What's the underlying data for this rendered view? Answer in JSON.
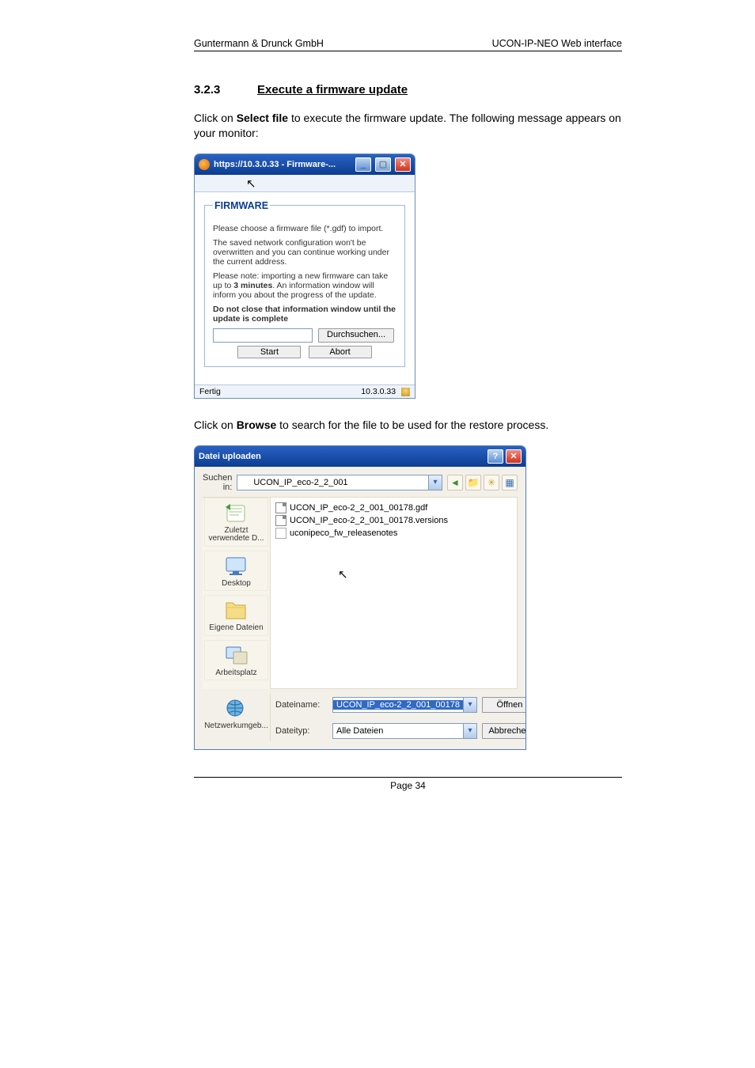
{
  "header": {
    "left": "Guntermann & Drunck GmbH",
    "right": "UCON-IP-NEO Web interface"
  },
  "section": {
    "num": "3.2.3",
    "title": "Execute a firmware update"
  },
  "intro": {
    "pre": "Click on ",
    "bold": "Select file",
    "post": " to execute the firmware update. The following message appears on your monitor:"
  },
  "fw": {
    "winTitle": "https://10.3.0.33 - Firmware-...",
    "legend": "FIRMWARE",
    "p1": "Please choose a firmware file (*.gdf) to import.",
    "p2": "The saved network configuration won't be overwritten and you can continue working under the current address.",
    "p3_a": "Please note: importing a new firmware can take up to ",
    "p3_b": "3 minutes",
    "p3_c": ". An information window will inform you about the progress of the update.",
    "p4": "Do not close that information window until the update is complete",
    "browse": "Durchsuchen...",
    "start": "Start",
    "abort": "Abort",
    "statusLeft": "Fertig",
    "statusRight": "10.3.0.33"
  },
  "between": {
    "pre": "Click on ",
    "bold": "Browse",
    "post": " to search for the file to be used for the restore process."
  },
  "dlg": {
    "title": "Datei uploaden",
    "lookInLabel": "Suchen in:",
    "lookInValue": "UCON_IP_eco-2_2_001",
    "files": [
      "UCON_IP_eco-2_2_001_00178.gdf",
      "UCON_IP_eco-2_2_001_00178.versions",
      "uconipeco_fw_releasenotes"
    ],
    "places": {
      "recent": "Zuletzt verwendete D...",
      "desktop": "Desktop",
      "mydocs": "Eigene Dateien",
      "mycomp": "Arbeitsplatz",
      "mynet": "Netzwerkumgeb..."
    },
    "fnLabel": "Dateiname:",
    "fnValue": "UCON_IP_eco-2_2_001_00178",
    "ftLabel": "Dateityp:",
    "ftValue": "Alle Dateien",
    "open": "Öffnen",
    "cancel": "Abbrechen"
  },
  "footer": "Page 34"
}
